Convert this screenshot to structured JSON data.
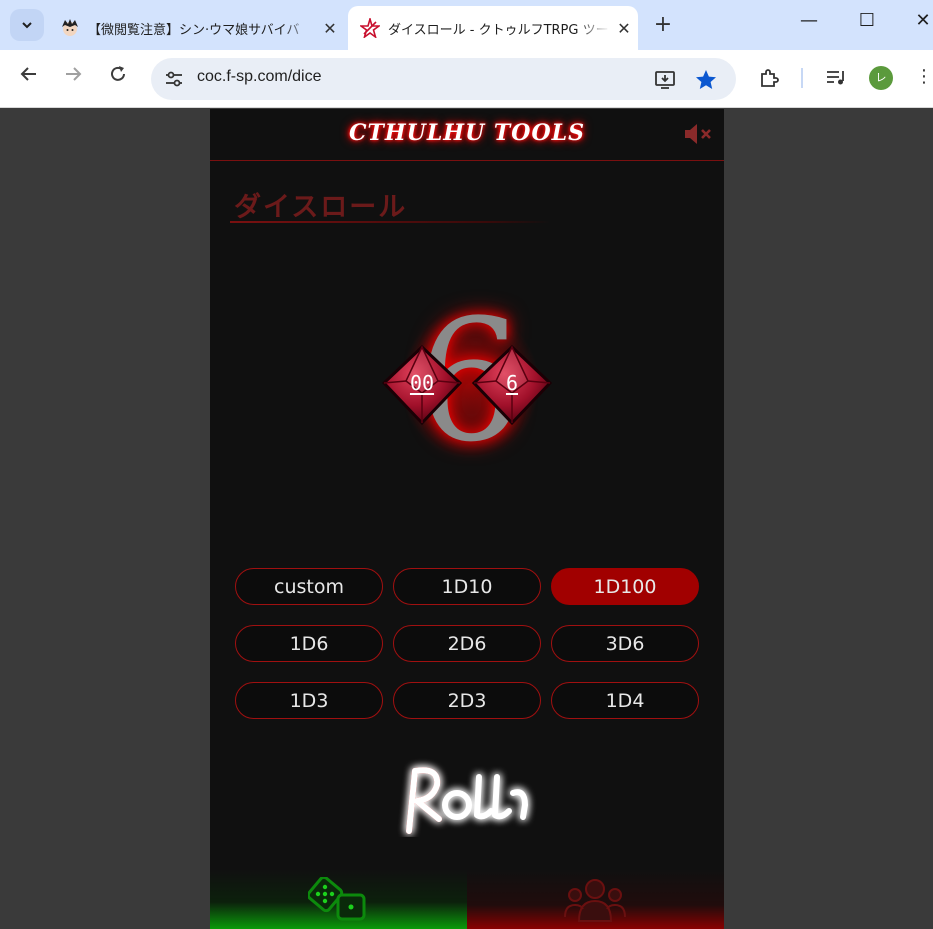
{
  "browser": {
    "tabs": [
      {
        "title": "【微閲覧注意】シン·ウマ娘サバイバ",
        "active": false,
        "favicon": "anime-avatar-icon"
      },
      {
        "title": "ダイスロール - クトゥルフTRPG ツール",
        "active": true,
        "favicon": "red-star-icon"
      }
    ],
    "new_tab": "+",
    "window_controls": {
      "minimize": "—",
      "maximize": "☐",
      "close": "✕"
    },
    "url": "coc.f-sp.com/dice",
    "profile_initial": "レ",
    "accent_color": "#d3e3fd"
  },
  "site": {
    "logo": "CTHULHU TOOLS",
    "mute_icon": "speaker-muted-icon"
  },
  "dice_page": {
    "title": "ダイスロール",
    "result": "6",
    "dice": [
      {
        "face": "00",
        "type": "d10-tens"
      },
      {
        "face": "6",
        "type": "d10-ones"
      }
    ],
    "buttons": [
      {
        "label": "custom",
        "active": false
      },
      {
        "label": "1D10",
        "active": false
      },
      {
        "label": "1D100",
        "active": true
      },
      {
        "label": "1D6",
        "active": false
      },
      {
        "label": "2D6",
        "active": false
      },
      {
        "label": "3D6",
        "active": false
      },
      {
        "label": "1D3",
        "active": false
      },
      {
        "label": "2D3",
        "active": false
      },
      {
        "label": "1D4",
        "active": false
      }
    ],
    "roll_label": "ROLL",
    "colors": {
      "accent": "#a10000",
      "nav_dice": "#0a9a0a",
      "nav_members": "#8a0000"
    }
  },
  "bottom_nav": [
    {
      "icon": "dice-icon",
      "active": true
    },
    {
      "icon": "users-icon",
      "active": false
    }
  ]
}
